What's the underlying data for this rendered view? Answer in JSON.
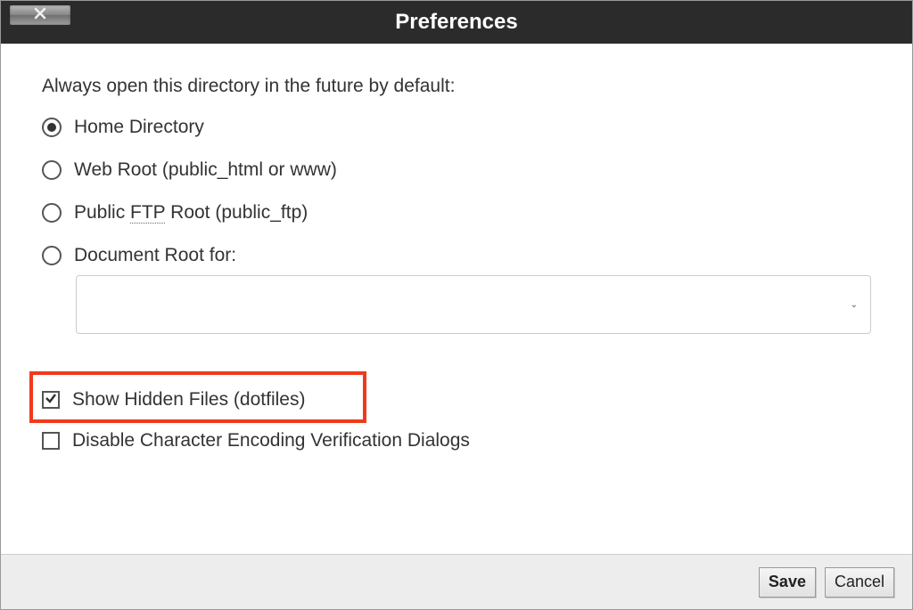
{
  "title": "Preferences",
  "prompt": "Always open this directory in the future by default:",
  "radios": [
    {
      "label": "Home Directory",
      "selected": true
    },
    {
      "label_pre": "Web Root (public_html or www)",
      "selected": false
    },
    {
      "label_pre": "Public ",
      "abbr": "FTP",
      "label_post": " Root (public_ftp)",
      "selected": false
    },
    {
      "label_pre": "Document Root for:",
      "selected": false,
      "has_select": true
    }
  ],
  "document_root_select": {
    "value": ""
  },
  "checkboxes": [
    {
      "label": "Show Hidden Files (dotfiles)",
      "checked": true,
      "highlighted": true
    },
    {
      "label": "Disable Character Encoding Verification Dialogs",
      "checked": false,
      "highlighted": false
    }
  ],
  "buttons": {
    "save": "Save",
    "cancel": "Cancel"
  },
  "highlight_color": "#ef3a1c"
}
